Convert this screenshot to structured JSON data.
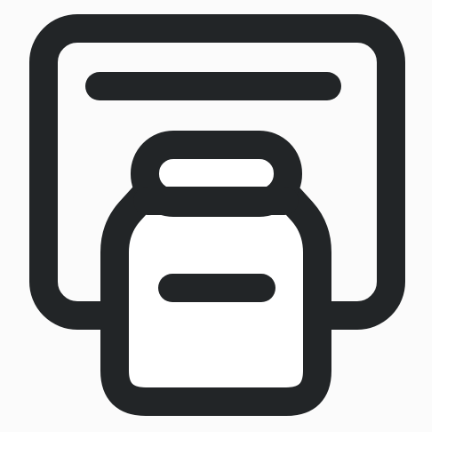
{
  "icon": {
    "name": "clipboard-jar-icon",
    "stroke_color": "#222527",
    "fill_color": "#ffffff",
    "background_color": "#fbfbfb"
  }
}
